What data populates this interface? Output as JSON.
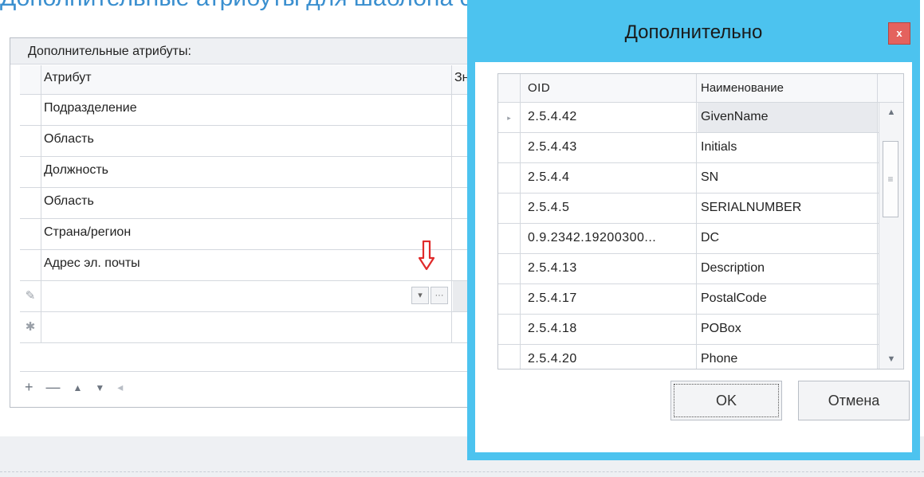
{
  "heading_fragment": "Дополнительные атрибуты для шаблона сертификата",
  "attributes_panel": {
    "title": "Дополнительные атрибуты:",
    "columns": [
      "Атрибут",
      "Зн"
    ],
    "rows": [
      {
        "attribute": "Подразделение",
        "value": ""
      },
      {
        "attribute": "Область",
        "value": ""
      },
      {
        "attribute": "Должность",
        "value": ""
      },
      {
        "attribute": "Область",
        "value": ""
      },
      {
        "attribute": "Страна/регион",
        "value": ""
      },
      {
        "attribute": "Адрес эл. почты",
        "value": ""
      }
    ],
    "edit_row": {
      "indicator": "✎",
      "dropdown_label": "▾",
      "ellipsis_label": "···"
    },
    "new_row": {
      "indicator": "✱"
    },
    "navigator": {
      "add": "+",
      "remove": "—",
      "up": "▲",
      "down": "▼",
      "left": "◂"
    }
  },
  "dialog": {
    "title": "Дополнительно",
    "close_label": "x",
    "columns": [
      "OID",
      "Наименование"
    ],
    "rows": [
      {
        "oid": "2.5.4.42",
        "name": "GivenName",
        "selected": true
      },
      {
        "oid": "2.5.4.43",
        "name": "Initials"
      },
      {
        "oid": "2.5.4.4",
        "name": "SN"
      },
      {
        "oid": "2.5.4.5",
        "name": "SERIALNUMBER"
      },
      {
        "oid": "0.9.2342.19200300...",
        "name": "DC"
      },
      {
        "oid": "2.5.4.13",
        "name": "Description"
      },
      {
        "oid": "2.5.4.17",
        "name": "PostalCode"
      },
      {
        "oid": "2.5.4.18",
        "name": "POBox"
      },
      {
        "oid": "2.5.4.20",
        "name": "Phone"
      }
    ],
    "selected_indicator": "▸",
    "scroll": {
      "up": "▲",
      "down": "▼",
      "grip": "≡"
    },
    "ok_label": "OK",
    "cancel_label": "Отмена"
  },
  "colors": {
    "dialog_frame": "#4cc3ef",
    "close_button": "#e4625e",
    "heading": "#3a8fcf",
    "arrow": "#e02a2a"
  }
}
